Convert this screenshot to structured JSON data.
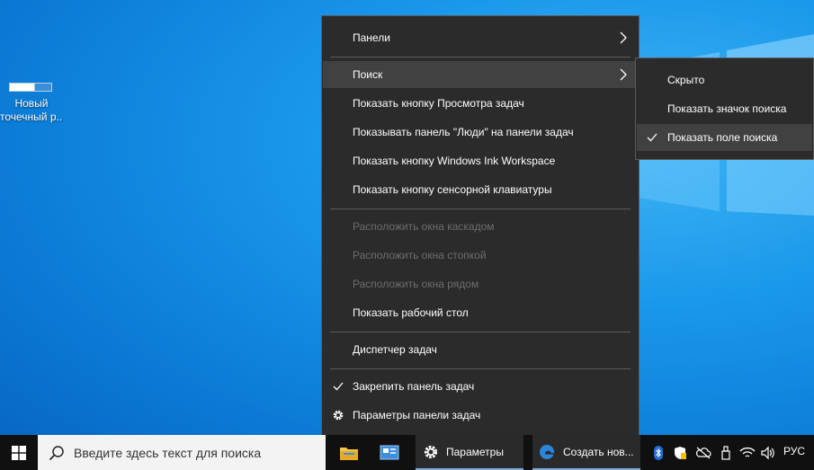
{
  "desktop": {
    "icon_line1": "Новый",
    "icon_line2": "точечный р..."
  },
  "context_menu": {
    "items": [
      {
        "label": "Панели",
        "submenu": true
      },
      {
        "label": "Поиск",
        "submenu": true,
        "highlighted": true
      },
      {
        "label": "Показать кнопку Просмотра задач"
      },
      {
        "label": "Показывать панель \"Люди\" на панели задач"
      },
      {
        "label": "Показать кнопку Windows Ink Workspace"
      },
      {
        "label": "Показать кнопку сенсорной клавиатуры"
      },
      {
        "label": "Расположить окна каскадом",
        "disabled": true
      },
      {
        "label": "Расположить окна стопкой",
        "disabled": true
      },
      {
        "label": "Расположить окна рядом",
        "disabled": true
      },
      {
        "label": "Показать рабочий стол"
      },
      {
        "label": "Диспетчер задач"
      },
      {
        "label": "Закрепить панель задач",
        "checked": true
      },
      {
        "label": "Параметры панели задач",
        "icon": "gear-icon"
      }
    ]
  },
  "search_submenu": {
    "items": [
      {
        "label": "Скрыто"
      },
      {
        "label": "Показать значок поиска"
      },
      {
        "label": "Показать поле поиска",
        "checked": true,
        "highlighted": true
      }
    ]
  },
  "taskbar": {
    "search_placeholder": "Введите здесь текст для поиска",
    "settings_label": "Параметры",
    "edge_label": "Создать нов...",
    "language": "РУС"
  },
  "colors": {
    "menu_bg": "#2b2b2b",
    "menu_highlight": "#414141",
    "taskbar_bg": "#101010",
    "accent": "#0a78d4"
  }
}
